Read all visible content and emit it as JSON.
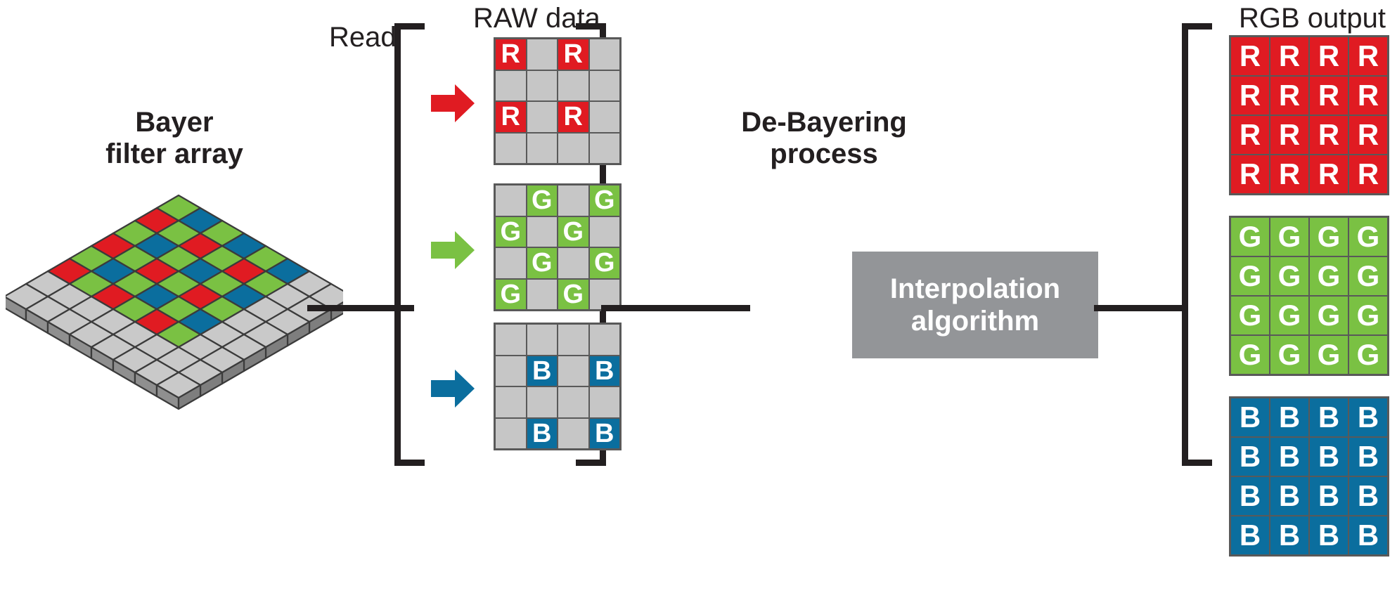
{
  "diagram": {
    "title_left": "Bayer\nfilter array",
    "left_label_line1": "Bayer",
    "left_label_line2": "filter array",
    "read_label": "Read",
    "raw_label": "RAW data",
    "rgb_label": "RGB output",
    "process_label_line1": "De-Bayering",
    "process_label_line2": "process",
    "interpolation_label_line1": "Interpolation",
    "interpolation_label_line2": "algorithm"
  },
  "colors": {
    "red": "#e01b22",
    "green": "#7ac143",
    "blue": "#0b6e9e",
    "empty": "#c6c6c6",
    "gridline": "#595959",
    "box_gray": "#939598",
    "ink": "#231f20"
  },
  "arrows": [
    {
      "name": "red-arrow",
      "color": "#e01b22"
    },
    {
      "name": "green-arrow",
      "color": "#7ac143"
    },
    {
      "name": "blue-arrow",
      "color": "#0b6e9e"
    }
  ],
  "raw_channels": [
    {
      "name": "red",
      "letter": "R",
      "cells": [
        [
          "R",
          "",
          "R",
          ""
        ],
        [
          "",
          "",
          "",
          ""
        ],
        [
          "R",
          "",
          "R",
          ""
        ],
        [
          "",
          "",
          "",
          ""
        ]
      ]
    },
    {
      "name": "green",
      "letter": "G",
      "cells": [
        [
          "",
          "G",
          "",
          "G"
        ],
        [
          "G",
          "",
          "G",
          ""
        ],
        [
          "",
          "G",
          "",
          "G"
        ],
        [
          "G",
          "",
          "G",
          ""
        ]
      ]
    },
    {
      "name": "blue",
      "letter": "B",
      "cells": [
        [
          "",
          "",
          "",
          ""
        ],
        [
          "",
          "B",
          "",
          "B"
        ],
        [
          "",
          "",
          "",
          ""
        ],
        [
          "",
          "B",
          "",
          "B"
        ]
      ]
    }
  ],
  "output_channels": [
    {
      "name": "red",
      "letter": "R",
      "cells": [
        [
          "R",
          "R",
          "R",
          "R"
        ],
        [
          "R",
          "R",
          "R",
          "R"
        ],
        [
          "R",
          "R",
          "R",
          "R"
        ],
        [
          "R",
          "R",
          "R",
          "R"
        ]
      ]
    },
    {
      "name": "green",
      "letter": "G",
      "cells": [
        [
          "G",
          "G",
          "G",
          "G"
        ],
        [
          "G",
          "G",
          "G",
          "G"
        ],
        [
          "G",
          "G",
          "G",
          "G"
        ],
        [
          "G",
          "G",
          "G",
          "G"
        ]
      ]
    },
    {
      "name": "blue",
      "letter": "B",
      "cells": [
        [
          "B",
          "B",
          "B",
          "B"
        ],
        [
          "B",
          "B",
          "B",
          "B"
        ],
        [
          "B",
          "B",
          "B",
          "B"
        ],
        [
          "B",
          "B",
          "B",
          "B"
        ]
      ]
    }
  ],
  "bayer_array": {
    "description": "isometric Bayer color filter array on sensor",
    "pattern": [
      "G",
      "B",
      "R",
      "G"
    ],
    "rows": 8,
    "cols": 8
  }
}
